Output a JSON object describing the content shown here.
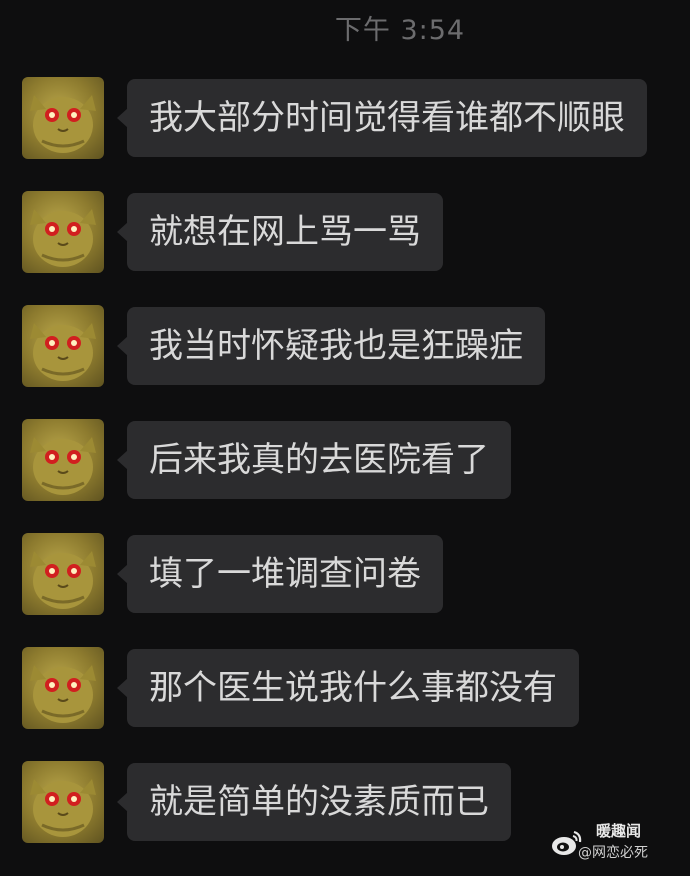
{
  "chat": {
    "timestamp": "下午 3:54",
    "messages": [
      {
        "text": "我大部分时间觉得看谁都不顺眼"
      },
      {
        "text": "就想在网上骂一骂"
      },
      {
        "text": "我当时怀疑我也是狂躁症"
      },
      {
        "text": "后来我真的去医院看了"
      },
      {
        "text": "填了一堆调查问卷"
      },
      {
        "text": "那个医生说我什么事都没有"
      },
      {
        "text": "就是简单的没素质而已"
      }
    ],
    "avatar_icon": "golden-cat-red-eyes-avatar"
  },
  "watermark": {
    "top_text": "暖趣闻",
    "bottom_text": "@网恋必死",
    "logo_icon": "weibo-logo-icon"
  }
}
